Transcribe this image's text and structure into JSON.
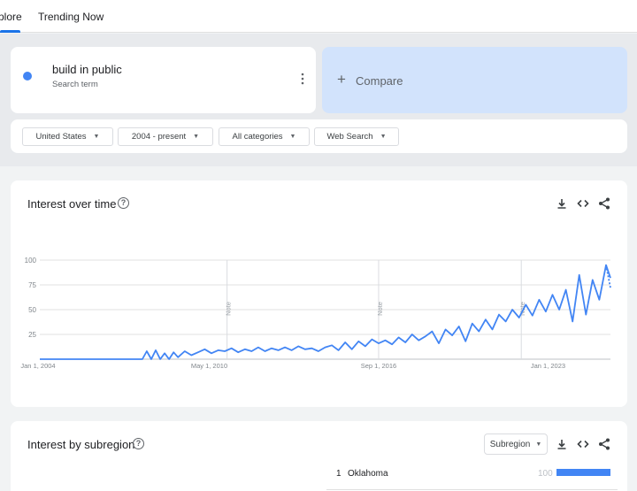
{
  "nav": {
    "tabs": [
      {
        "label": "plore"
      },
      {
        "label": "Trending Now"
      }
    ]
  },
  "search_term": {
    "title": "build in public",
    "subtitle": "Search term",
    "color": "#4285f4"
  },
  "compare": {
    "label": "Compare"
  },
  "filters": {
    "region": "United States",
    "time": "2004 - present",
    "category": "All categories",
    "property": "Web Search"
  },
  "interest_over_time": {
    "title": "Interest over time",
    "notes": [
      "Note",
      "Note",
      "Note"
    ]
  },
  "interest_by_subregion": {
    "title": "Interest by subregion",
    "select_label": "Subregion",
    "rows": [
      {
        "rank": "1",
        "name": "Oklahoma",
        "value": "100",
        "fraction": 1.0
      }
    ]
  },
  "chart_data": {
    "type": "line",
    "title": "",
    "xlabel": "",
    "ylabel": "",
    "x_ticks": [
      "Jan 1, 2004",
      "May 1, 2010",
      "Sep 1, 2016",
      "Jan 1, 2023"
    ],
    "y_ticks": [
      100,
      75,
      50,
      25
    ],
    "ylim": [
      0,
      100
    ],
    "xlim": [
      "2004-01",
      "2025-05"
    ],
    "grid": true,
    "color": "#4285f4",
    "series": [
      {
        "x": [
          "2004-01",
          "2005-01",
          "2006-01",
          "2007-01",
          "2007-06",
          "2007-09",
          "2007-11",
          "2008-01",
          "2008-03",
          "2008-05",
          "2008-07",
          "2008-09",
          "2008-11",
          "2009-01",
          "2009-03",
          "2009-06",
          "2009-09",
          "2009-12",
          "2010-03",
          "2010-06",
          "2010-09",
          "2010-12",
          "2011-03",
          "2011-06",
          "2011-09",
          "2011-12",
          "2012-03",
          "2012-06",
          "2012-09",
          "2012-12",
          "2013-03",
          "2013-06",
          "2013-09",
          "2013-12",
          "2014-03",
          "2014-06",
          "2014-09",
          "2014-12",
          "2015-03",
          "2015-06",
          "2015-09",
          "2015-12",
          "2016-03",
          "2016-06",
          "2016-09",
          "2016-12",
          "2017-03",
          "2017-06",
          "2017-09",
          "2017-12",
          "2018-03",
          "2018-06",
          "2018-09",
          "2018-12",
          "2019-03",
          "2019-06",
          "2019-09",
          "2019-12",
          "2020-03",
          "2020-06",
          "2020-09",
          "2020-12",
          "2021-03",
          "2021-06",
          "2021-09",
          "2021-12",
          "2022-03",
          "2022-06",
          "2022-09",
          "2022-12",
          "2023-03",
          "2023-06",
          "2023-09",
          "2023-12",
          "2024-03",
          "2024-06",
          "2024-09",
          "2024-12",
          "2025-03",
          "2025-05"
        ],
        "values": [
          0,
          0,
          0,
          0,
          0,
          0,
          0,
          8,
          0,
          9,
          0,
          6,
          0,
          7,
          2,
          8,
          4,
          7,
          10,
          6,
          9,
          8,
          11,
          7,
          10,
          8,
          12,
          8,
          11,
          9,
          12,
          9,
          13,
          10,
          11,
          8,
          12,
          14,
          9,
          17,
          10,
          18,
          13,
          20,
          16,
          19,
          15,
          22,
          17,
          25,
          19,
          23,
          28,
          16,
          30,
          24,
          33,
          18,
          36,
          28,
          40,
          30,
          45,
          38,
          50,
          42,
          55,
          44,
          60,
          48,
          65,
          50,
          70,
          38,
          85,
          45,
          80,
          60,
          95,
          82
        ]
      }
    ]
  }
}
